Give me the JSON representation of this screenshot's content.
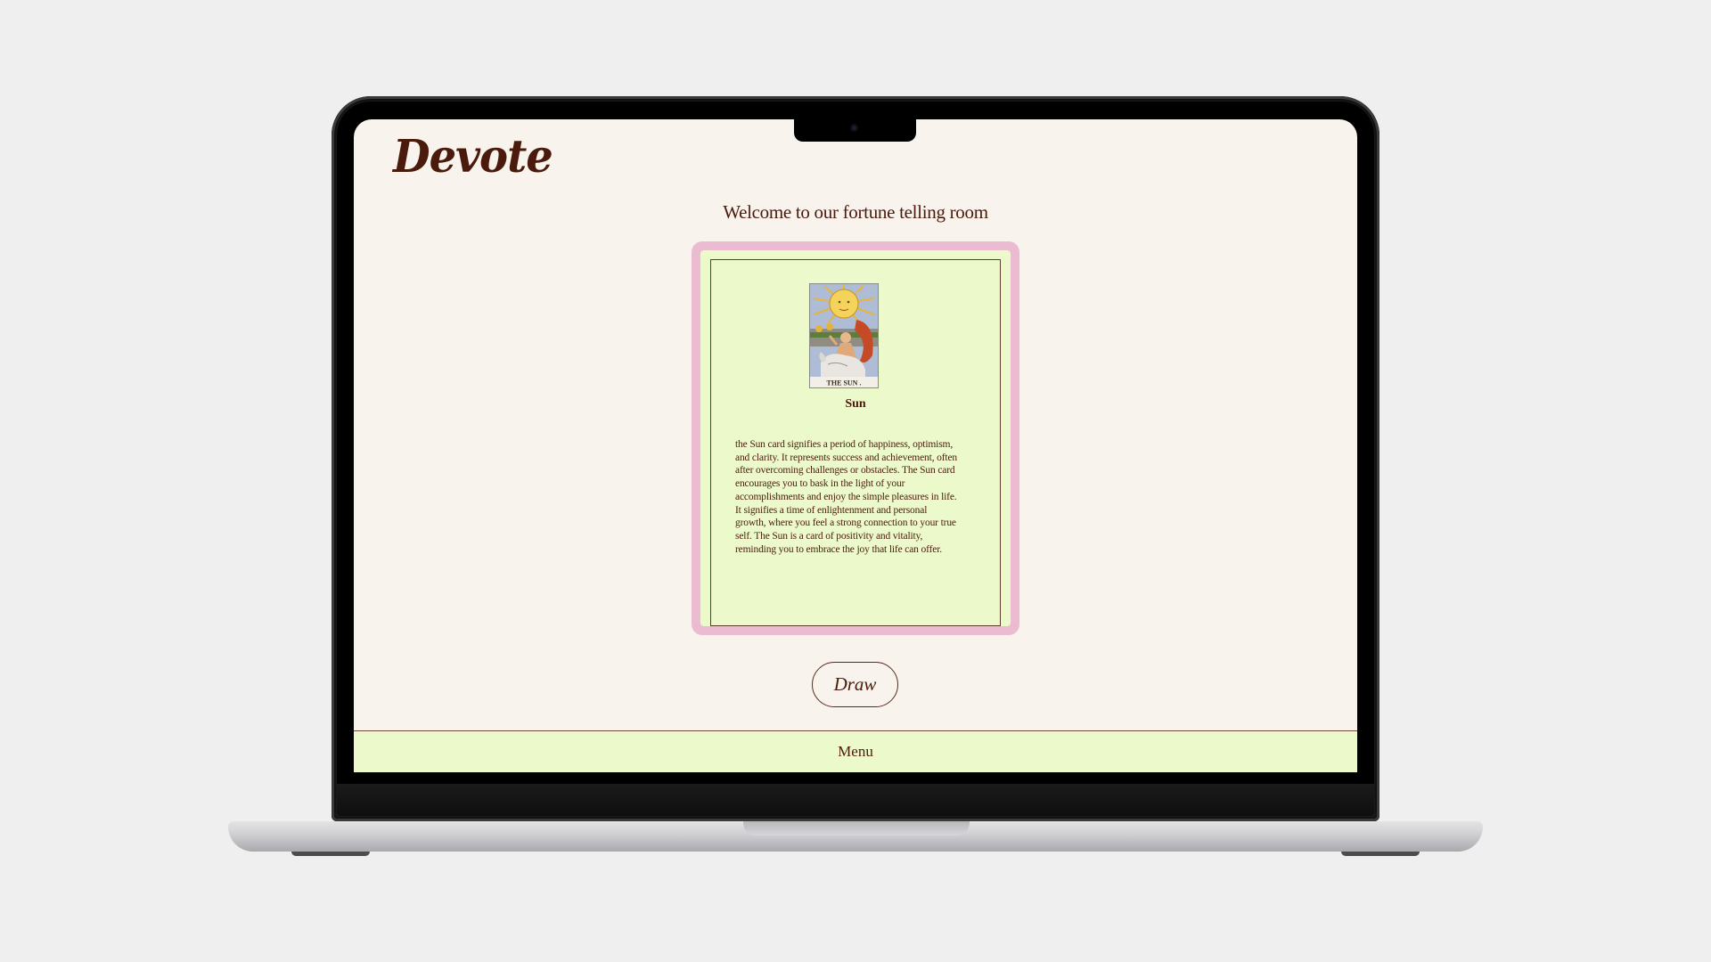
{
  "brand": {
    "logo_text": "Devote"
  },
  "main": {
    "welcome_heading": "Welcome to our fortune telling room",
    "card": {
      "name": "Sun",
      "image_caption": "THE SUN .",
      "description": "the Sun card signifies a period of happiness, optimism, and clarity. It represents success and achievement, often after overcoming challenges or obstacles. The Sun card encourages you to bask in the light of your accomplishments and enjoy the simple pleasures in life. It signifies a time of enlightenment and personal growth, where you feel a strong connection to your true self. The Sun is a card of positivity and vitality, reminding you to embrace the joy that life can offer."
    },
    "draw_button_label": "Draw"
  },
  "footer": {
    "menu_label": "Menu"
  },
  "colors": {
    "page_background": "#f8f3ec",
    "text_brown": "#4a1a0c",
    "card_frame_pink": "#ebbbd2",
    "card_background_green": "#ecfacb",
    "menu_bar_green": "#ecfacb"
  },
  "icons": {
    "camera": "webcam-dot"
  }
}
